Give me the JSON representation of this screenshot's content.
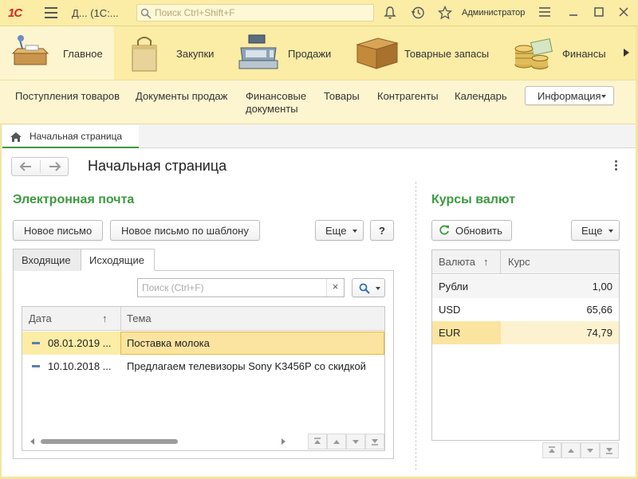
{
  "titlebar": {
    "logo": "1С",
    "app_title": "Д...  (1С:...",
    "search_placeholder": "Поиск Ctrl+Shift+F",
    "user": "Администратор"
  },
  "sections": [
    {
      "label": "Главное",
      "icon": "desk-icon",
      "active": true
    },
    {
      "label": "Закупки",
      "icon": "shopping-bag-icon",
      "active": false
    },
    {
      "label": "Продажи",
      "icon": "cash-register-icon",
      "active": false
    },
    {
      "label": "Товарные запасы",
      "icon": "box-icon",
      "active": false
    },
    {
      "label": "Финансы",
      "icon": "coins-icon",
      "active": false
    }
  ],
  "commands": {
    "items": [
      "Поступления товаров",
      "Документы продаж",
      "Финансовые документы",
      "Товары",
      "Контрагенты",
      "Календарь"
    ],
    "finance_line1": "Финансовые",
    "finance_line2": "документы",
    "info_button": "Информация"
  },
  "open_tab": {
    "label": "Начальная страница"
  },
  "page": {
    "title": "Начальная страница"
  },
  "email": {
    "title": "Электронная почта",
    "new_letter": "Новое письмо",
    "new_from_template": "Новое письмо по шаблону",
    "more": "Еще",
    "help": "?",
    "tabs": [
      {
        "label": "Входящие",
        "active": false
      },
      {
        "label": "Исходящие",
        "active": true
      }
    ],
    "search_placeholder": "Поиск (Ctrl+F)",
    "search_clear": "×",
    "columns": {
      "date": "Дата",
      "subject": "Тема",
      "sort_arrow": "↑"
    },
    "rows": [
      {
        "date": "08.01.2019 ...",
        "subject": "Поставка молока",
        "selected": true
      },
      {
        "date": "10.10.2018 ...",
        "subject": "Предлагаем телевизоры Sony K3456P со скидкой",
        "selected": false
      }
    ]
  },
  "currency": {
    "title": "Курсы валют",
    "refresh": "Обновить",
    "more": "Еще",
    "columns": {
      "currency": "Валюта",
      "rate": "Курс",
      "sort_arrow": "↑"
    },
    "rows": [
      {
        "name": "Рубли",
        "rate": "1,00",
        "selected": false
      },
      {
        "name": "USD",
        "rate": "65,66",
        "selected": false
      },
      {
        "name": "EUR",
        "rate": "74,79",
        "selected": true
      }
    ]
  },
  "colors": {
    "accent_green": "#3c9a3f",
    "panel_yellow": "#fbeca6",
    "selection": "#fbe4a0"
  }
}
